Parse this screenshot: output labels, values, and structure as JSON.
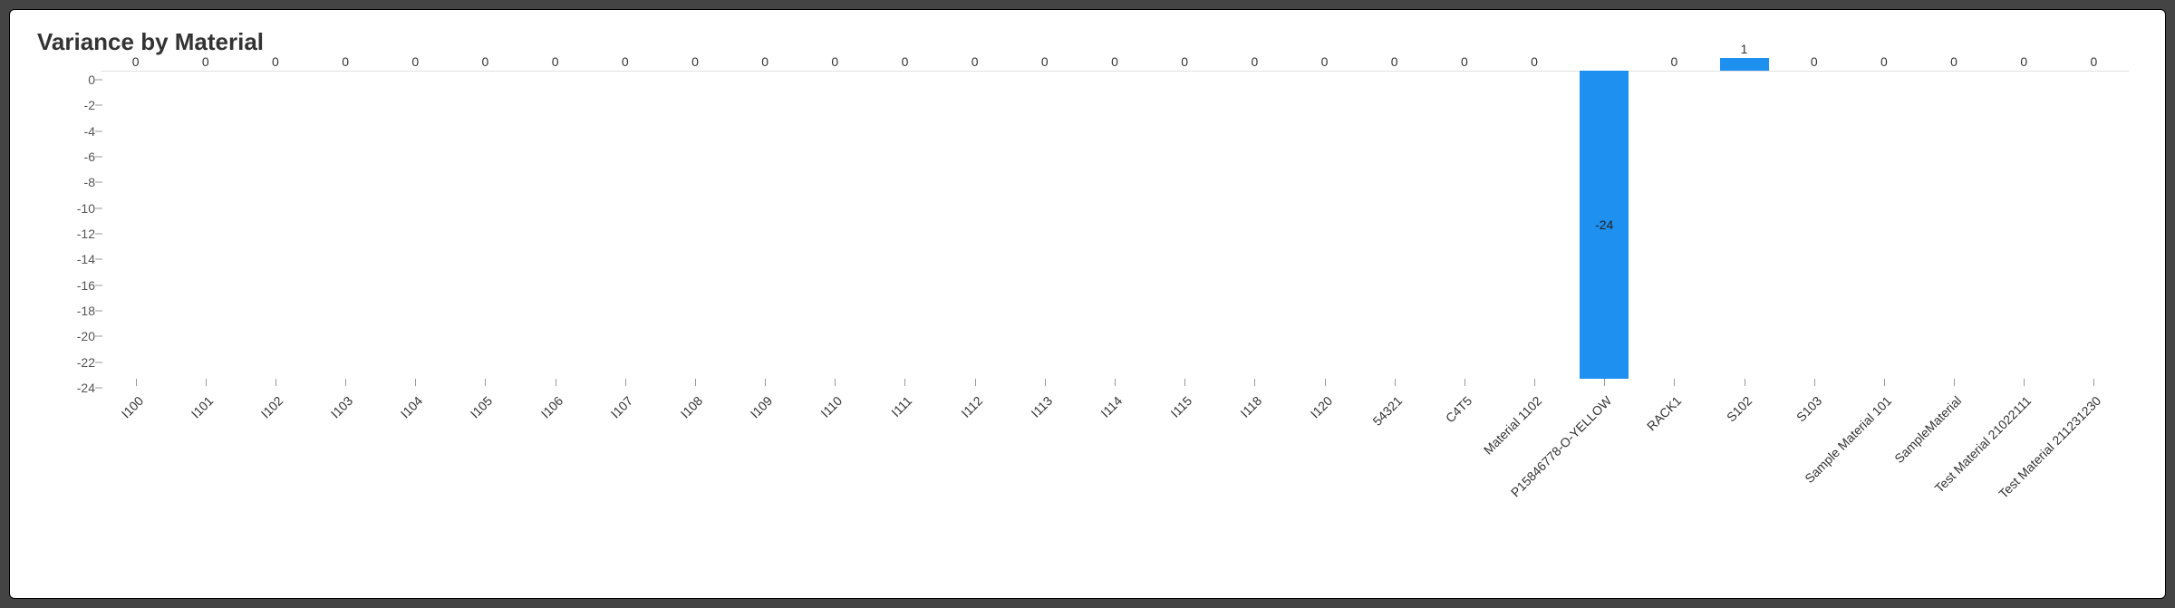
{
  "title": "Variance by Material",
  "chart_data": {
    "type": "bar",
    "title": "Variance by Material",
    "xlabel": "",
    "ylabel": "",
    "ylim": [
      -24,
      1
    ],
    "y_ticks": [
      0,
      -2,
      -4,
      -6,
      -8,
      -10,
      -12,
      -14,
      -16,
      -18,
      -20,
      -22,
      -24
    ],
    "categories": [
      "I100",
      "I101",
      "I102",
      "I103",
      "I104",
      "I105",
      "I106",
      "I107",
      "I108",
      "I109",
      "I110",
      "I111",
      "I112",
      "I113",
      "I114",
      "I115",
      "I118",
      "I120",
      "54321",
      "C4T5",
      "Material 1102",
      "P15846778-O-YELLOW",
      "RACK1",
      "S102",
      "S103",
      "Sample Material 101",
      "SampleMaterial",
      "Test Material 21022111",
      "Test Material 211231230"
    ],
    "values": [
      0,
      0,
      0,
      0,
      0,
      0,
      0,
      0,
      0,
      0,
      0,
      0,
      0,
      0,
      0,
      0,
      0,
      0,
      0,
      0,
      0,
      -24,
      0,
      1,
      0,
      0,
      0,
      0,
      0
    ]
  },
  "colors": {
    "bar": "#1e90f0"
  }
}
